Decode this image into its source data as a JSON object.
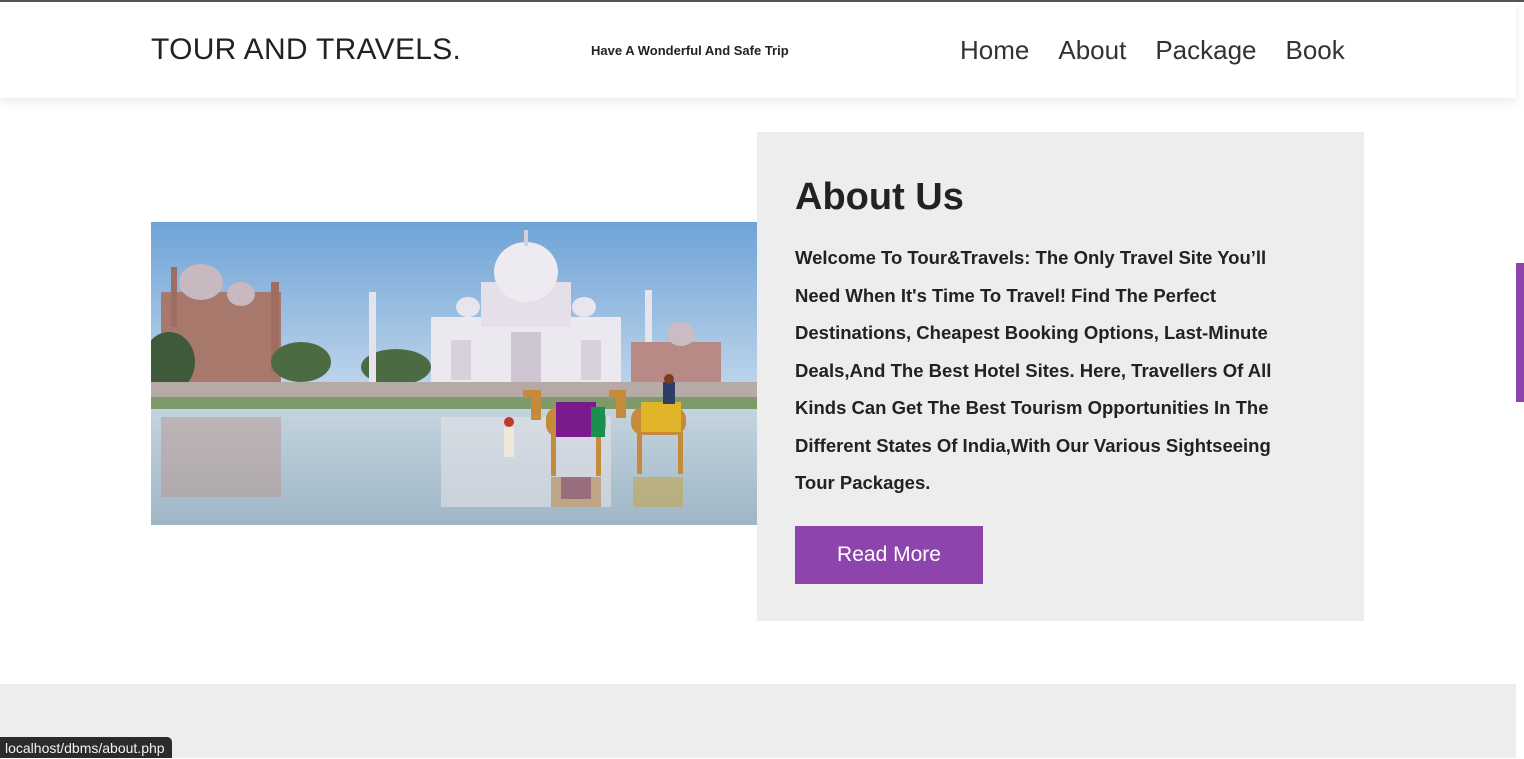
{
  "header": {
    "brand": "TOUR AND TRAVELS.",
    "tagline": "Have A Wonderful And Safe Trip",
    "nav": [
      "Home",
      "About",
      "Package",
      "Book"
    ]
  },
  "about": {
    "title": "About Us",
    "text": "Welcome To Tour&Travels: The Only Travel Site You’ll Need When It's Time To Travel! Find The Perfect Destinations, Cheapest Booking Options, Last-Minute Deals,And The Best Hotel Sites. Here, Travellers Of All Kinds Can Get The Best Tourism Opportunities In The Different States Of India,With Our Various Sightseeing Tour Packages.",
    "button": "Read More",
    "image": "taj-mahal-camels-photo"
  },
  "status_bar": {
    "url": "localhost/dbms/about.php"
  },
  "colors": {
    "accent": "#8e44ad",
    "panel": "#eeeded",
    "text": "#222222"
  }
}
